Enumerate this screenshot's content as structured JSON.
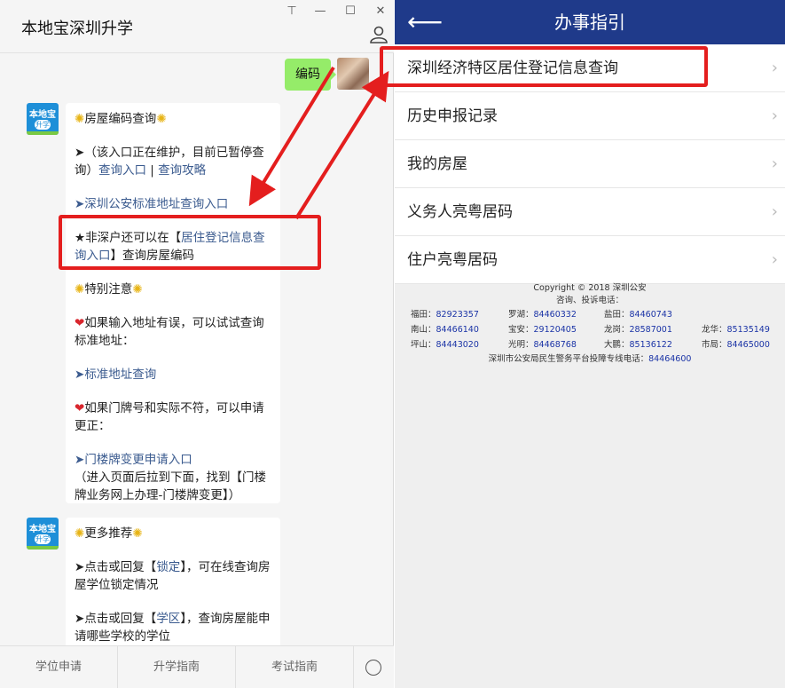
{
  "chat": {
    "title": "本地宝深圳升学",
    "window_buttons": [
      "⊤",
      "—",
      "☐",
      "✕"
    ],
    "my_message": "编码",
    "bot_avatar": {
      "top": "本地宝",
      "pill": "升学"
    },
    "msg1": {
      "p1": "房屋编码查询",
      "p2a": "➤（该入口正在维护，目前已暂停查询）",
      "p2_link1": "查询入口",
      "p2_sep": " | ",
      "p2_link2": "查询攻略",
      "p3": "➤深圳公安标准地址查询入口",
      "p4a": "★非深户还可以在【",
      "p4_link": "居住登记信息查询入口",
      "p4b": "】查询房屋编码",
      "p5": "特别注意",
      "p6": "如果输入地址有误，可以试试查询标准地址：",
      "p7_arrow": "➤",
      "p7_link": "标准地址查询",
      "p8": "如果门牌号和实际不符，可以申请更正：",
      "p9_arrow": "➤",
      "p9_link": "门楼牌变更申请入口",
      "p10": "（进入页面后拉到下面，找到【门楼牌业务网上办理-门楼牌变更】）"
    },
    "msg2": {
      "p1": "更多推荐",
      "p2a": "➤点击或回复【",
      "p2_link": "锁定",
      "p2b": "】，可在线查询房屋学位锁定情况",
      "p3a": "➤点击或回复【",
      "p3_link": "学区",
      "p3b": "】，查询房屋能申请哪些学校的学位"
    },
    "tabs": [
      "学位申请",
      "升学指南",
      "考试指南"
    ]
  },
  "phone": {
    "title": "办事指引",
    "menu": [
      {
        "label": "深圳经济特区居住登记信息查询"
      },
      {
        "label": "历史申报记录"
      },
      {
        "label": "我的房屋"
      },
      {
        "label": "义务人亮粤居码"
      },
      {
        "label": "住户亮粤居码"
      }
    ],
    "copyright": "Copyright © 2018 深圳公安",
    "contact_title": "咨询、投诉电话：",
    "phones": [
      [
        {
          "k": "福田：",
          "v": "82923357"
        },
        {
          "k": "罗湖：",
          "v": "84460332"
        },
        {
          "k": "盐田：",
          "v": "84460743"
        }
      ],
      [
        {
          "k": "南山：",
          "v": "84466140"
        },
        {
          "k": "宝安：",
          "v": "29120405"
        },
        {
          "k": "龙岗：",
          "v": "28587001"
        },
        {
          "k": "龙华：",
          "v": "85135149"
        }
      ],
      [
        {
          "k": "坪山：",
          "v": "84443020"
        },
        {
          "k": "光明：",
          "v": "84468768"
        },
        {
          "k": "大鹏：",
          "v": "85136122"
        },
        {
          "k": "市局：",
          "v": "84465000"
        }
      ]
    ],
    "hotline_label": "深圳市公安局民生警务平台投障专线电话：",
    "hotline_number": "84464600"
  },
  "colors": {
    "accent_red": "#e41e1e",
    "header_blue": "#1f3a8a",
    "bubble_green": "#95ec69",
    "link": "#3b5b8f"
  }
}
